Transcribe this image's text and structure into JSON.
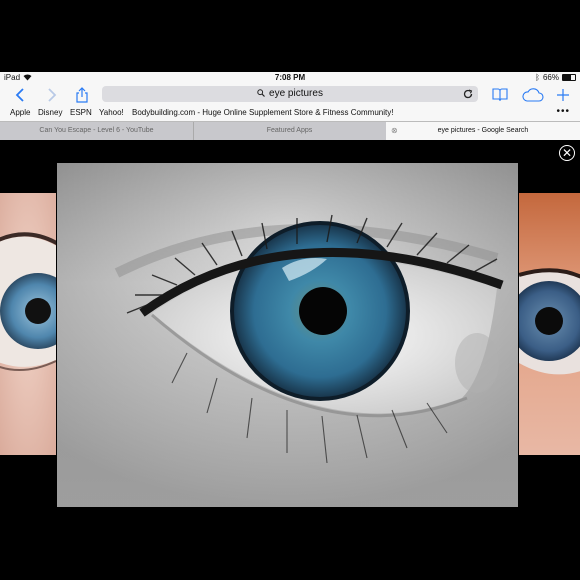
{
  "status": {
    "device": "iPad",
    "time": "7:08 PM",
    "battery": "66%"
  },
  "toolbar": {
    "search_query": "eye pictures",
    "icons": [
      "back-icon",
      "forward-icon",
      "share-icon",
      "magnifier-icon",
      "reload-icon",
      "bookmarks-icon",
      "cloud-tabs-icon",
      "new-tab-icon"
    ]
  },
  "bookmarks": [
    {
      "label": "Apple"
    },
    {
      "label": "Disney"
    },
    {
      "label": "ESPN"
    },
    {
      "label": "Yahoo!"
    },
    {
      "label": "Bodybuilding.com - Huge Online Supplement Store & Fitness Community!"
    }
  ],
  "tabs": [
    {
      "label": "Can You Escape - Level 6 - YouTube",
      "active": false
    },
    {
      "label": "Featured Apps",
      "active": false
    },
    {
      "label": "eye pictures - Google Search",
      "active": true
    }
  ],
  "viewer": {
    "main_image": "close-up of a blue eye, black and white with color iris",
    "colors": {
      "iris": "#2e6d92",
      "skin": "#e7e7e7",
      "background": "#000000"
    }
  }
}
